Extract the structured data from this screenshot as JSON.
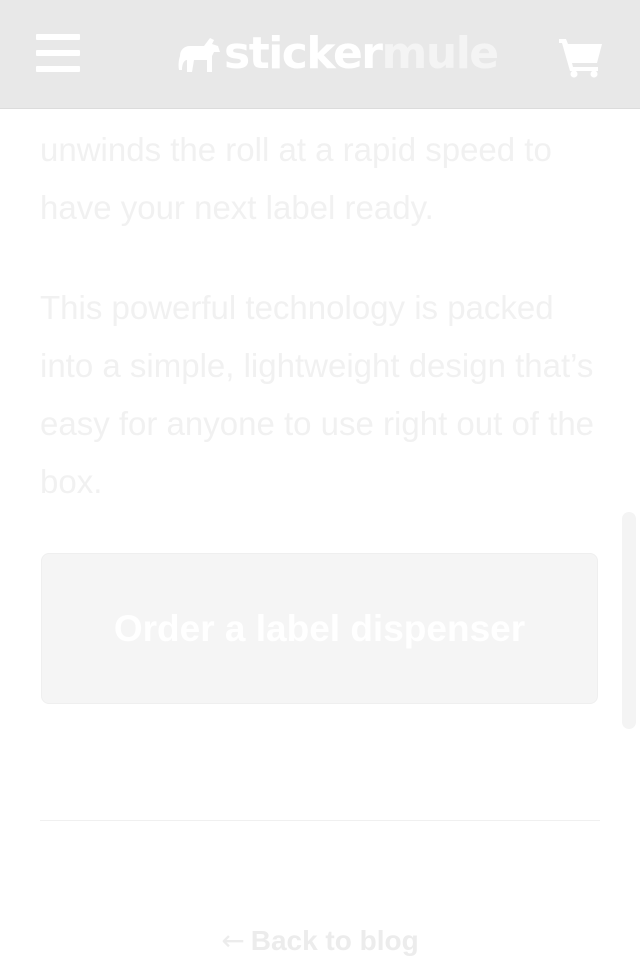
{
  "header": {
    "menu_icon": "hamburger-menu-icon",
    "logo": {
      "icon": "mule-logo-icon",
      "text_primary": "sticker",
      "text_secondary": "mule"
    },
    "cart_icon": "shopping-cart-icon",
    "background": "#e8e8e8"
  },
  "article": {
    "paragraph_1": "unwinds the roll at a rapid speed to have your next label ready.",
    "paragraph_2": "This powerful technology is packed into a simple, lightweight design that’s easy for anyone to use right out of the box."
  },
  "cta": {
    "label": "Order a label dispenser"
  },
  "footer": {
    "back_arrow": "←",
    "back_label": "Back to blog"
  },
  "colors": {
    "text": "#f1f1f1",
    "button_bg": "#f5f5f5",
    "button_text": "#ffffff"
  }
}
